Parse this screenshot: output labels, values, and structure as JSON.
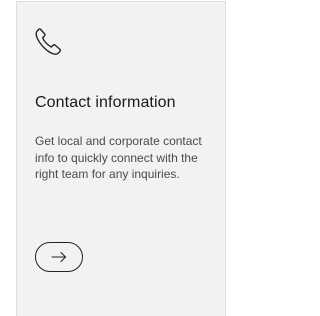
{
  "card": {
    "icon": "phone-icon",
    "title": "Contact information",
    "description": "Get local and corporate contact info to quickly connect with the right team for any inquiries.",
    "action_icon": "arrow-right-icon"
  }
}
